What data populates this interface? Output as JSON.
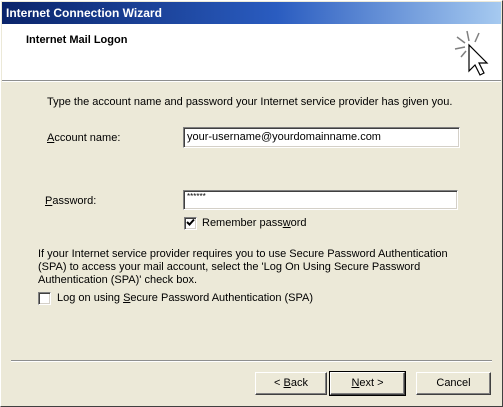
{
  "window": {
    "title": "Internet Connection Wizard"
  },
  "header": {
    "title": "Internet Mail Logon",
    "icon": "wizard-sparkle-cursor-icon"
  },
  "intro_text": "Type the account name and password your Internet service provider has given you.",
  "account": {
    "label_prefix": "",
    "label_accel": "A",
    "label_rest": "ccount name:",
    "value": "your-username@yourdomainname.com"
  },
  "password": {
    "label_accel": "P",
    "label_rest": "assword:",
    "masked_value": "******"
  },
  "remember": {
    "label_prefix": "Remember pass",
    "label_accel": "w",
    "label_rest": "ord",
    "checked": true
  },
  "spa_info_text_line1": "If your Internet service provider requires you to use Secure Password Authentication",
  "spa_info_text_line2": "(SPA) to access your mail account, select the 'Log On Using Secure Password",
  "spa_info_text_line3": "Authentication (SPA)' check box.",
  "spa": {
    "label_prefix": "Log on using ",
    "label_accel": "S",
    "label_rest": "ecure Password Authentication (SPA)",
    "checked": false
  },
  "buttons": {
    "back_prefix": "< ",
    "back_accel": "B",
    "back_rest": "ack",
    "next_accel": "N",
    "next_rest": "ext >",
    "cancel": "Cancel"
  }
}
